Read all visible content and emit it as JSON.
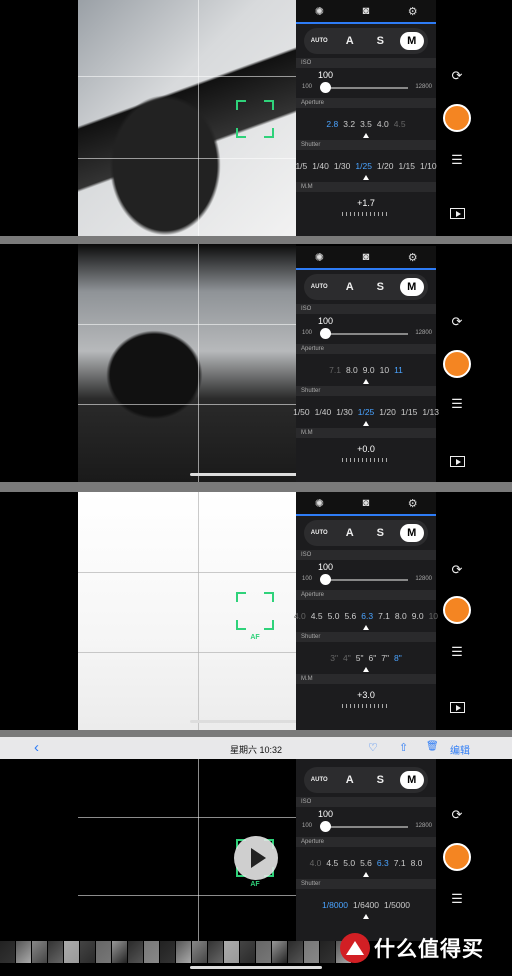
{
  "camera_tabs": {
    "aperture_icon": "aperture-icon",
    "camera_icon": "camera-icon",
    "settings_icon": "gear-icon"
  },
  "modes": {
    "auto": "AUTO",
    "a": "A",
    "s": "S",
    "m": "M"
  },
  "labels": {
    "iso": "ISO",
    "aperture": "Aperture",
    "shutter": "Shutter",
    "mm": "M.M",
    "af": "AF"
  },
  "iso": {
    "min": "100",
    "max": "12800"
  },
  "panels": [
    {
      "iso_value": "100",
      "aperture_values": [
        "2.8",
        "3.2",
        "3.5",
        "4.0",
        "4.5"
      ],
      "aperture_active": 0,
      "shutter_values": [
        "1/5",
        "1/40",
        "1/30",
        "1/25",
        "1/20",
        "1/15",
        "1/10"
      ],
      "shutter_active": 3,
      "mm_value": "+1.7"
    },
    {
      "iso_value": "100",
      "aperture_values": [
        "7.1",
        "8.0",
        "9.0",
        "10",
        "11"
      ],
      "aperture_active": 4,
      "shutter_values": [
        "1/50",
        "1/40",
        "1/30",
        "1/25",
        "1/20",
        "1/15",
        "1/13"
      ],
      "shutter_active": 3,
      "mm_value": "+0.0"
    },
    {
      "iso_value": "100",
      "aperture_values": [
        "4.0",
        "4.5",
        "5.0",
        "5.6",
        "6.3",
        "7.1",
        "8.0",
        "9.0",
        "10"
      ],
      "aperture_active": 4,
      "shutter_values": [
        "3\"",
        "4\"",
        "5\"",
        "6\"",
        "7\"",
        "8\""
      ],
      "shutter_active": 5,
      "mm_value": "+3.0"
    },
    {
      "iso_value": "100",
      "aperture_values": [
        "4.0",
        "4.5",
        "5.0",
        "5.6",
        "6.3",
        "7.1",
        "8.0"
      ],
      "aperture_active": 4,
      "shutter_values": [
        "1/8000",
        "1/6400",
        "1/5000"
      ],
      "shutter_active": 0,
      "mm_value": ""
    }
  ],
  "side_icons": {
    "flip": "camera-flip-icon",
    "settings": "sliders-icon",
    "gallery": "gallery-play-icon"
  },
  "photos_bar": {
    "back": "‹",
    "date": "星期六 10:32",
    "heart": "♡",
    "share": "⇧",
    "trash": "🗑",
    "edit": "编辑"
  },
  "watermark": {
    "text": "什么值得买"
  },
  "colors": {
    "accent": "#2e7cf6",
    "shutter": "#f48522",
    "af": "#2fd27a"
  }
}
